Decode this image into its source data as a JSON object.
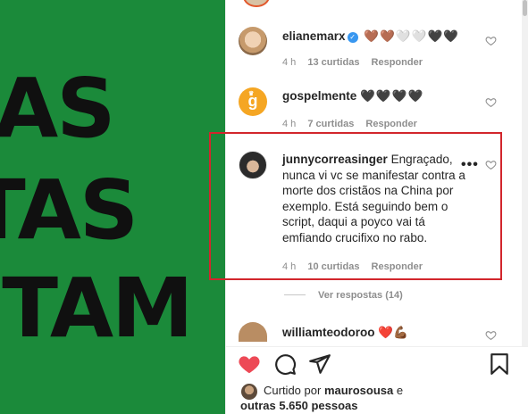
{
  "post_image": {
    "lines": [
      "AS",
      "TAS",
      "ITAM"
    ]
  },
  "comments": [
    {
      "username": "elianemarx",
      "text": "🤎🤎🤍🤍🖤🖤",
      "time": "4 h",
      "likes": "13 curtidas",
      "reply": "Responder",
      "verified": true
    },
    {
      "username": "gospelmente",
      "text": "🖤🖤🖤🖤",
      "time": "4 h",
      "likes": "7 curtidas",
      "reply": "Responder"
    },
    {
      "username": "junnycorreasinger",
      "text": "Engraçado, nunca vi vc se manifestar contra a morte dos cristãos na China por exemplo. Está seguindo bem o script, daqui a poyco vai tá emfiando crucifixo no rabo.",
      "time": "4 h",
      "likes": "10 curtidas",
      "reply": "Responder",
      "view_replies": "Ver respostas (14)"
    },
    {
      "username": "williamteodoroo",
      "text": "❤️💪🏾"
    }
  ],
  "avatar_letter": "g",
  "more_options": "•••",
  "liked_by": {
    "prefix": "Curtido por",
    "user": "maurosousa",
    "suffix": "e",
    "others": "outras 5.650 pessoas"
  },
  "icons": {
    "comment_like": "heart-outline-icon",
    "post_like": "heart-filled-icon",
    "comment": "comment-bubble-icon",
    "share": "paper-plane-icon",
    "save": "bookmark-icon"
  },
  "colors": {
    "accent_red": "#ed4956",
    "highlight_border": "#d2262c",
    "image_green": "#1b8a3a",
    "verified_blue": "#3897f0"
  }
}
